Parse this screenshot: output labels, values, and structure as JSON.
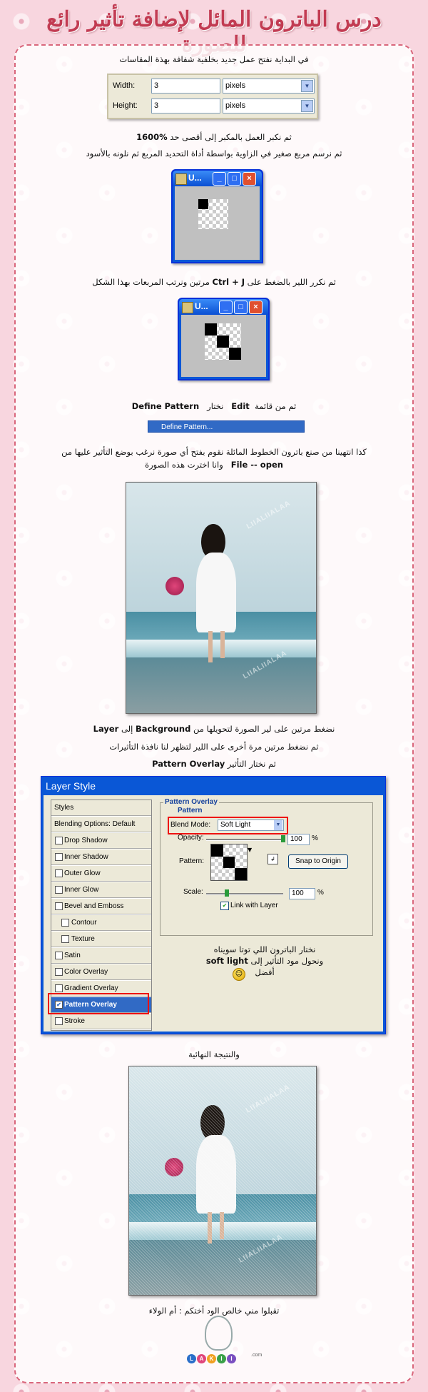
{
  "header": {
    "title": "درس الباترون المائل لإضافة تأثير رائع للصورة"
  },
  "steps": {
    "s1": "في البداية نفتح عمل جديد بخلفية شفافة بهذة المقاسات",
    "s2a": "ثم نكبر العمل بالمكبر إلى أقصى حد",
    "s2b": "1600%",
    "s3": "ثم نرسم مربع صغير في الزاوية بواسطة أداة التحديد المربع ثم نلونه بالأسود",
    "s4a": "ثم نكرر اللير بالضغط على",
    "s4b": "Ctrl + J",
    "s4c": "مرتين ونرتب المربعات بهذا الشكل",
    "s5a": "ثم من قائمة",
    "s5b": "Edit",
    "s5c": "نختار",
    "s5d": "Define Pattern",
    "s6a": "كذا انتهينا من صنع باترون الخطوط المائلة نقوم بفتح أي صورة نرغب بوضع التأثير عليها من",
    "s6b": "File -- open",
    "s6c": "وانا اخترت هذه الصورة",
    "s7a": "نضغط مرتين على لير الصورة لتحويلها من",
    "s7b": "Background",
    "s7c": "إلى",
    "s7d": "Layer",
    "s8": "ثم نضغط مرتين مرة أخرى على اللير لتظهر لنا نافذة التأثيرات",
    "s9a": "ثم نختار التأثير",
    "s9b": "Pattern Overlay",
    "s10": "والنتيجة النهائية",
    "s11": "تقبلوا مني خالص الود أختكم : أم الولاء"
  },
  "dims_dialog": {
    "width_label": "Width:",
    "width_value": "3",
    "width_unit": "pixels",
    "height_label": "Height:",
    "height_value": "3",
    "height_unit": "pixels"
  },
  "small_window": {
    "title": "U...",
    "min": "_",
    "max": "□",
    "close": "×"
  },
  "edit_menu": {
    "define_pattern": "Define Pattern..."
  },
  "watermark": "LIIALIIALAA",
  "layer_style": {
    "title": "Layer Style",
    "sidebar": [
      {
        "label": "Styles",
        "type": "head"
      },
      {
        "label": "Blending Options: Default",
        "type": "head"
      },
      {
        "label": "Drop Shadow",
        "type": "item"
      },
      {
        "label": "Inner Shadow",
        "type": "item"
      },
      {
        "label": "Outer Glow",
        "type": "item"
      },
      {
        "label": "Inner Glow",
        "type": "item"
      },
      {
        "label": "Bevel and Emboss",
        "type": "item"
      },
      {
        "label": "Contour",
        "type": "sub"
      },
      {
        "label": "Texture",
        "type": "sub"
      },
      {
        "label": "Satin",
        "type": "item"
      },
      {
        "label": "Color Overlay",
        "type": "item"
      },
      {
        "label": "Gradient Overlay",
        "type": "item"
      },
      {
        "label": "Pattern Overlay",
        "type": "selected"
      },
      {
        "label": "Stroke",
        "type": "item"
      }
    ],
    "group_title": "Pattern Overlay",
    "group_sub": "Pattern",
    "blend_label": "Blend Mode:",
    "blend_value": "Soft Light",
    "opacity_label": "Opacity:",
    "opacity_value": "100",
    "percent": "%",
    "pattern_label": "Pattern:",
    "snap_button": "Snap to Origin",
    "scale_label": "Scale:",
    "scale_value": "100",
    "link_label": "Link with Layer",
    "note_1": "نختار الباترون اللي توتا سويناه",
    "note_2": "ونحول مود التأثير إلى",
    "note_2b": "soft light",
    "note_3": "أفضل"
  },
  "logo": {
    "letters": [
      "L",
      "A",
      "K",
      "I",
      "I"
    ],
    "suffix": ".com",
    "colors": [
      "#2a6fc9",
      "#e0457a",
      "#f0a020",
      "#3aa048",
      "#7a4fc0"
    ]
  }
}
